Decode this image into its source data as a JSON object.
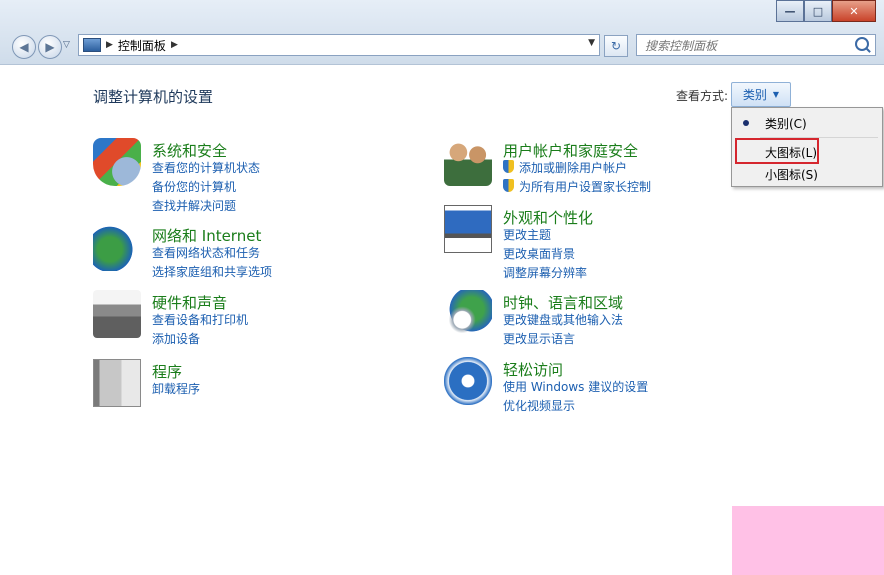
{
  "window": {
    "min_label": "—",
    "max_label": "□",
    "close_label": "✕"
  },
  "nav": {
    "back_glyph": "◀",
    "forward_glyph": "▶",
    "dropdown_glyph": "▽"
  },
  "address": {
    "icon": "control-panel-icon",
    "arrow1": "▶",
    "breadcrumb": "控制面板",
    "arrow2": "▶",
    "dropdown_glyph": "▼"
  },
  "refresh_glyph": "↻",
  "search": {
    "placeholder": "搜索控制面板"
  },
  "header": {
    "title": "调整计算机的设置",
    "view_by_label": "查看方式:",
    "view_by_value": "类别",
    "view_by_caret": "▼"
  },
  "view_menu": {
    "items": [
      {
        "label": "类别(C)",
        "selected": true
      },
      {
        "label": "大图标(L)",
        "selected": false,
        "highlighted": true
      },
      {
        "label": "小图标(S)",
        "selected": false
      }
    ],
    "highlight_color": "#d5262e"
  },
  "categories_left": [
    {
      "icon": "shield-security-icon",
      "title": "系统和安全",
      "links": [
        "查看您的计算机状态",
        "备份您的计算机",
        "查找并解决问题"
      ]
    },
    {
      "icon": "network-globe-icon",
      "title": "网络和 Internet",
      "links": [
        "查看网络状态和任务",
        "选择家庭组和共享选项"
      ]
    },
    {
      "icon": "printer-hardware-icon",
      "title": "硬件和声音",
      "links": [
        "查看设备和打印机",
        "添加设备"
      ]
    },
    {
      "icon": "programs-cd-icon",
      "title": "程序",
      "links": [
        "卸载程序"
      ]
    }
  ],
  "categories_right": [
    {
      "icon": "users-family-icon",
      "title": "用户帐户和家庭安全",
      "links": [
        "添加或删除用户帐户",
        "为所有用户设置家长控制"
      ],
      "shield_links": true
    },
    {
      "icon": "monitor-appearance-icon",
      "title": "外观和个性化",
      "links": [
        "更改主题",
        "更改桌面背景",
        "调整屏幕分辨率"
      ]
    },
    {
      "icon": "clock-globe-icon",
      "title": "时钟、语言和区域",
      "links": [
        "更改键盘或其他输入法",
        "更改显示语言"
      ]
    },
    {
      "icon": "ease-of-access-icon",
      "title": "轻松访问",
      "links": [
        "使用 Windows 建议的设置",
        "优化视频显示"
      ]
    }
  ],
  "colors": {
    "category_title": "#1a7d1a",
    "link": "#1c5fb0",
    "page_title": "#1e395b"
  }
}
